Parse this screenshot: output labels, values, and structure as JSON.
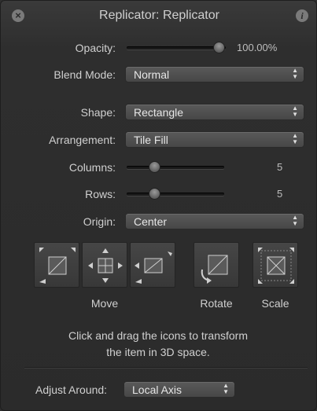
{
  "title": "Replicator: Replicator",
  "opacity": {
    "label": "Opacity:",
    "value": "100.00%",
    "level": 1.0
  },
  "blend_mode": {
    "label": "Blend Mode:",
    "value": "Normal"
  },
  "shape": {
    "label": "Shape:",
    "value": "Rectangle"
  },
  "arrangement": {
    "label": "Arrangement:",
    "value": "Tile Fill"
  },
  "columns": {
    "label": "Columns:",
    "value": "5"
  },
  "rows": {
    "label": "Rows:",
    "value": "5"
  },
  "origin": {
    "label": "Origin:",
    "value": "Center"
  },
  "transform": {
    "move_label": "Move",
    "rotate_label": "Rotate",
    "scale_label": "Scale"
  },
  "instructions": {
    "line1": "Click and drag the icons to transform",
    "line2": "the item in 3D space."
  },
  "adjust_around": {
    "label": "Adjust Around:",
    "value": "Local Axis"
  },
  "icons": {
    "close": "close-icon",
    "info": "info-icon",
    "popup": "chevron-updown-icon"
  }
}
